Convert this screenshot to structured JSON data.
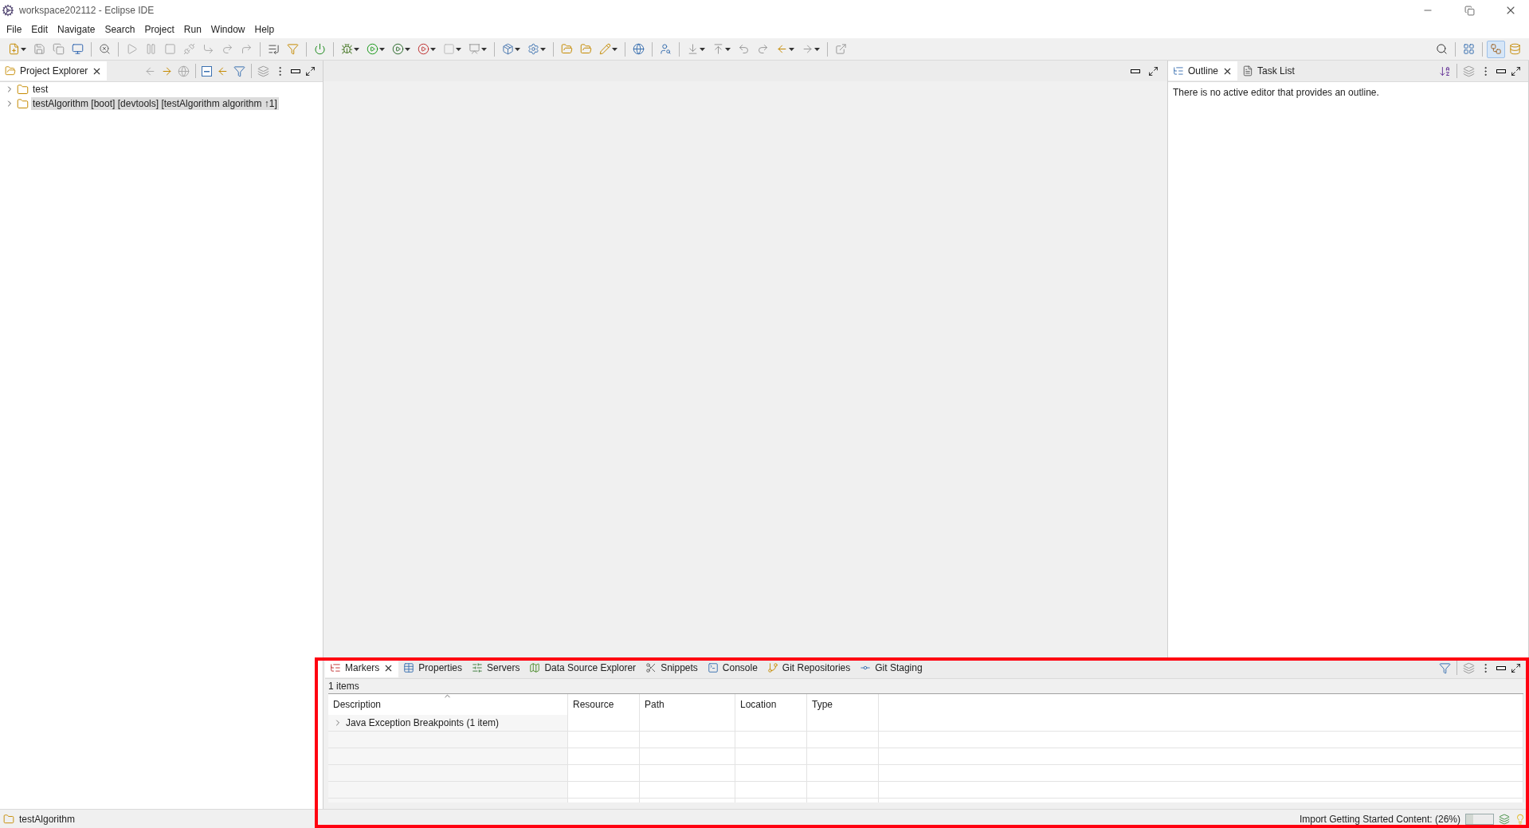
{
  "window": {
    "title": "workspace202112 - Eclipse IDE"
  },
  "menu": [
    "File",
    "Edit",
    "Navigate",
    "Search",
    "Project",
    "Run",
    "Window",
    "Help"
  ],
  "project_explorer": {
    "tabs": [
      {
        "label": "Project Explorer",
        "selected": true
      }
    ],
    "tree": [
      {
        "label": "test",
        "selected": false,
        "expanded": false
      },
      {
        "label": "testAlgorithm [boot] [devtools] [testAlgorithm algorithm ↑1]",
        "selected": true,
        "expanded": false
      }
    ]
  },
  "outline_panel": {
    "tabs": [
      {
        "label": "Outline",
        "selected": true
      },
      {
        "label": "Task List",
        "selected": false
      }
    ],
    "message": "There is no active editor that provides an outline."
  },
  "bottom_panel": {
    "highlighted": true,
    "tabs": [
      {
        "label": "Markers",
        "selected": true
      },
      {
        "label": "Properties",
        "selected": false
      },
      {
        "label": "Servers",
        "selected": false
      },
      {
        "label": "Data Source Explorer",
        "selected": false
      },
      {
        "label": "Snippets",
        "selected": false
      },
      {
        "label": "Console",
        "selected": false
      },
      {
        "label": "Git Repositories",
        "selected": false
      },
      {
        "label": "Git Staging",
        "selected": false
      }
    ],
    "summary": "1 items",
    "table": {
      "columns": [
        "Description",
        "Resource",
        "Path",
        "Location",
        "Type"
      ],
      "rows": [
        {
          "description": "Java Exception Breakpoints (1 item)",
          "expanded": false
        }
      ]
    }
  },
  "status_bar": {
    "left": "testAlgorithm",
    "progress_label": "Import Getting Started Content: (26%)",
    "progress": {
      "level": 0.26
    }
  }
}
